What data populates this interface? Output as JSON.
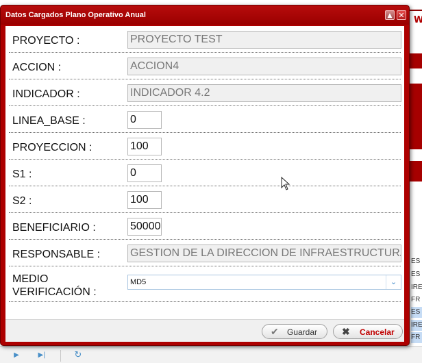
{
  "background": {
    "header_text": "W",
    "side_rows": [
      {
        "text": "ES",
        "highlight": false
      },
      {
        "text": "ES",
        "highlight": false
      },
      {
        "text": "IRE",
        "highlight": false
      },
      {
        "text": "FR",
        "highlight": false
      },
      {
        "text": "ES",
        "highlight": true
      },
      {
        "text": "IRE",
        "highlight": true
      },
      {
        "text": "FR",
        "highlight": true
      }
    ]
  },
  "dialog": {
    "title": "Datos Cargados Plano Operativo Anual",
    "fields": {
      "proyecto": {
        "label": "PROYECTO :",
        "value": "PROYECTO TEST"
      },
      "accion": {
        "label": "ACCION :",
        "value": "ACCION4"
      },
      "indicador": {
        "label": "INDICADOR :",
        "value": "INDICADOR 4.2"
      },
      "linea_base": {
        "label": "LINEA_BASE :",
        "value": "0"
      },
      "proyeccion": {
        "label": "PROYECCION :",
        "value": "100"
      },
      "s1": {
        "label": "S1 :",
        "value": "0"
      },
      "s2": {
        "label": "S2 :",
        "value": "100"
      },
      "beneficiario": {
        "label": "BENEFICIARIO :",
        "value": "50000"
      },
      "responsable": {
        "label": "RESPONSABLE :",
        "value": "GESTION DE LA DIRECCION DE INFRAESTRUCTURA"
      },
      "medio_verificacion": {
        "label_line1": "MEDIO",
        "label_line2": "VERIFICACIÓN :",
        "value": "MD5"
      }
    },
    "buttons": {
      "save": "Guardar",
      "cancel": "Cancelar"
    }
  },
  "colors": {
    "dialog_frame": "#ad0000",
    "cancel_text": "#c00000",
    "select_accent": "#3f88c9"
  }
}
